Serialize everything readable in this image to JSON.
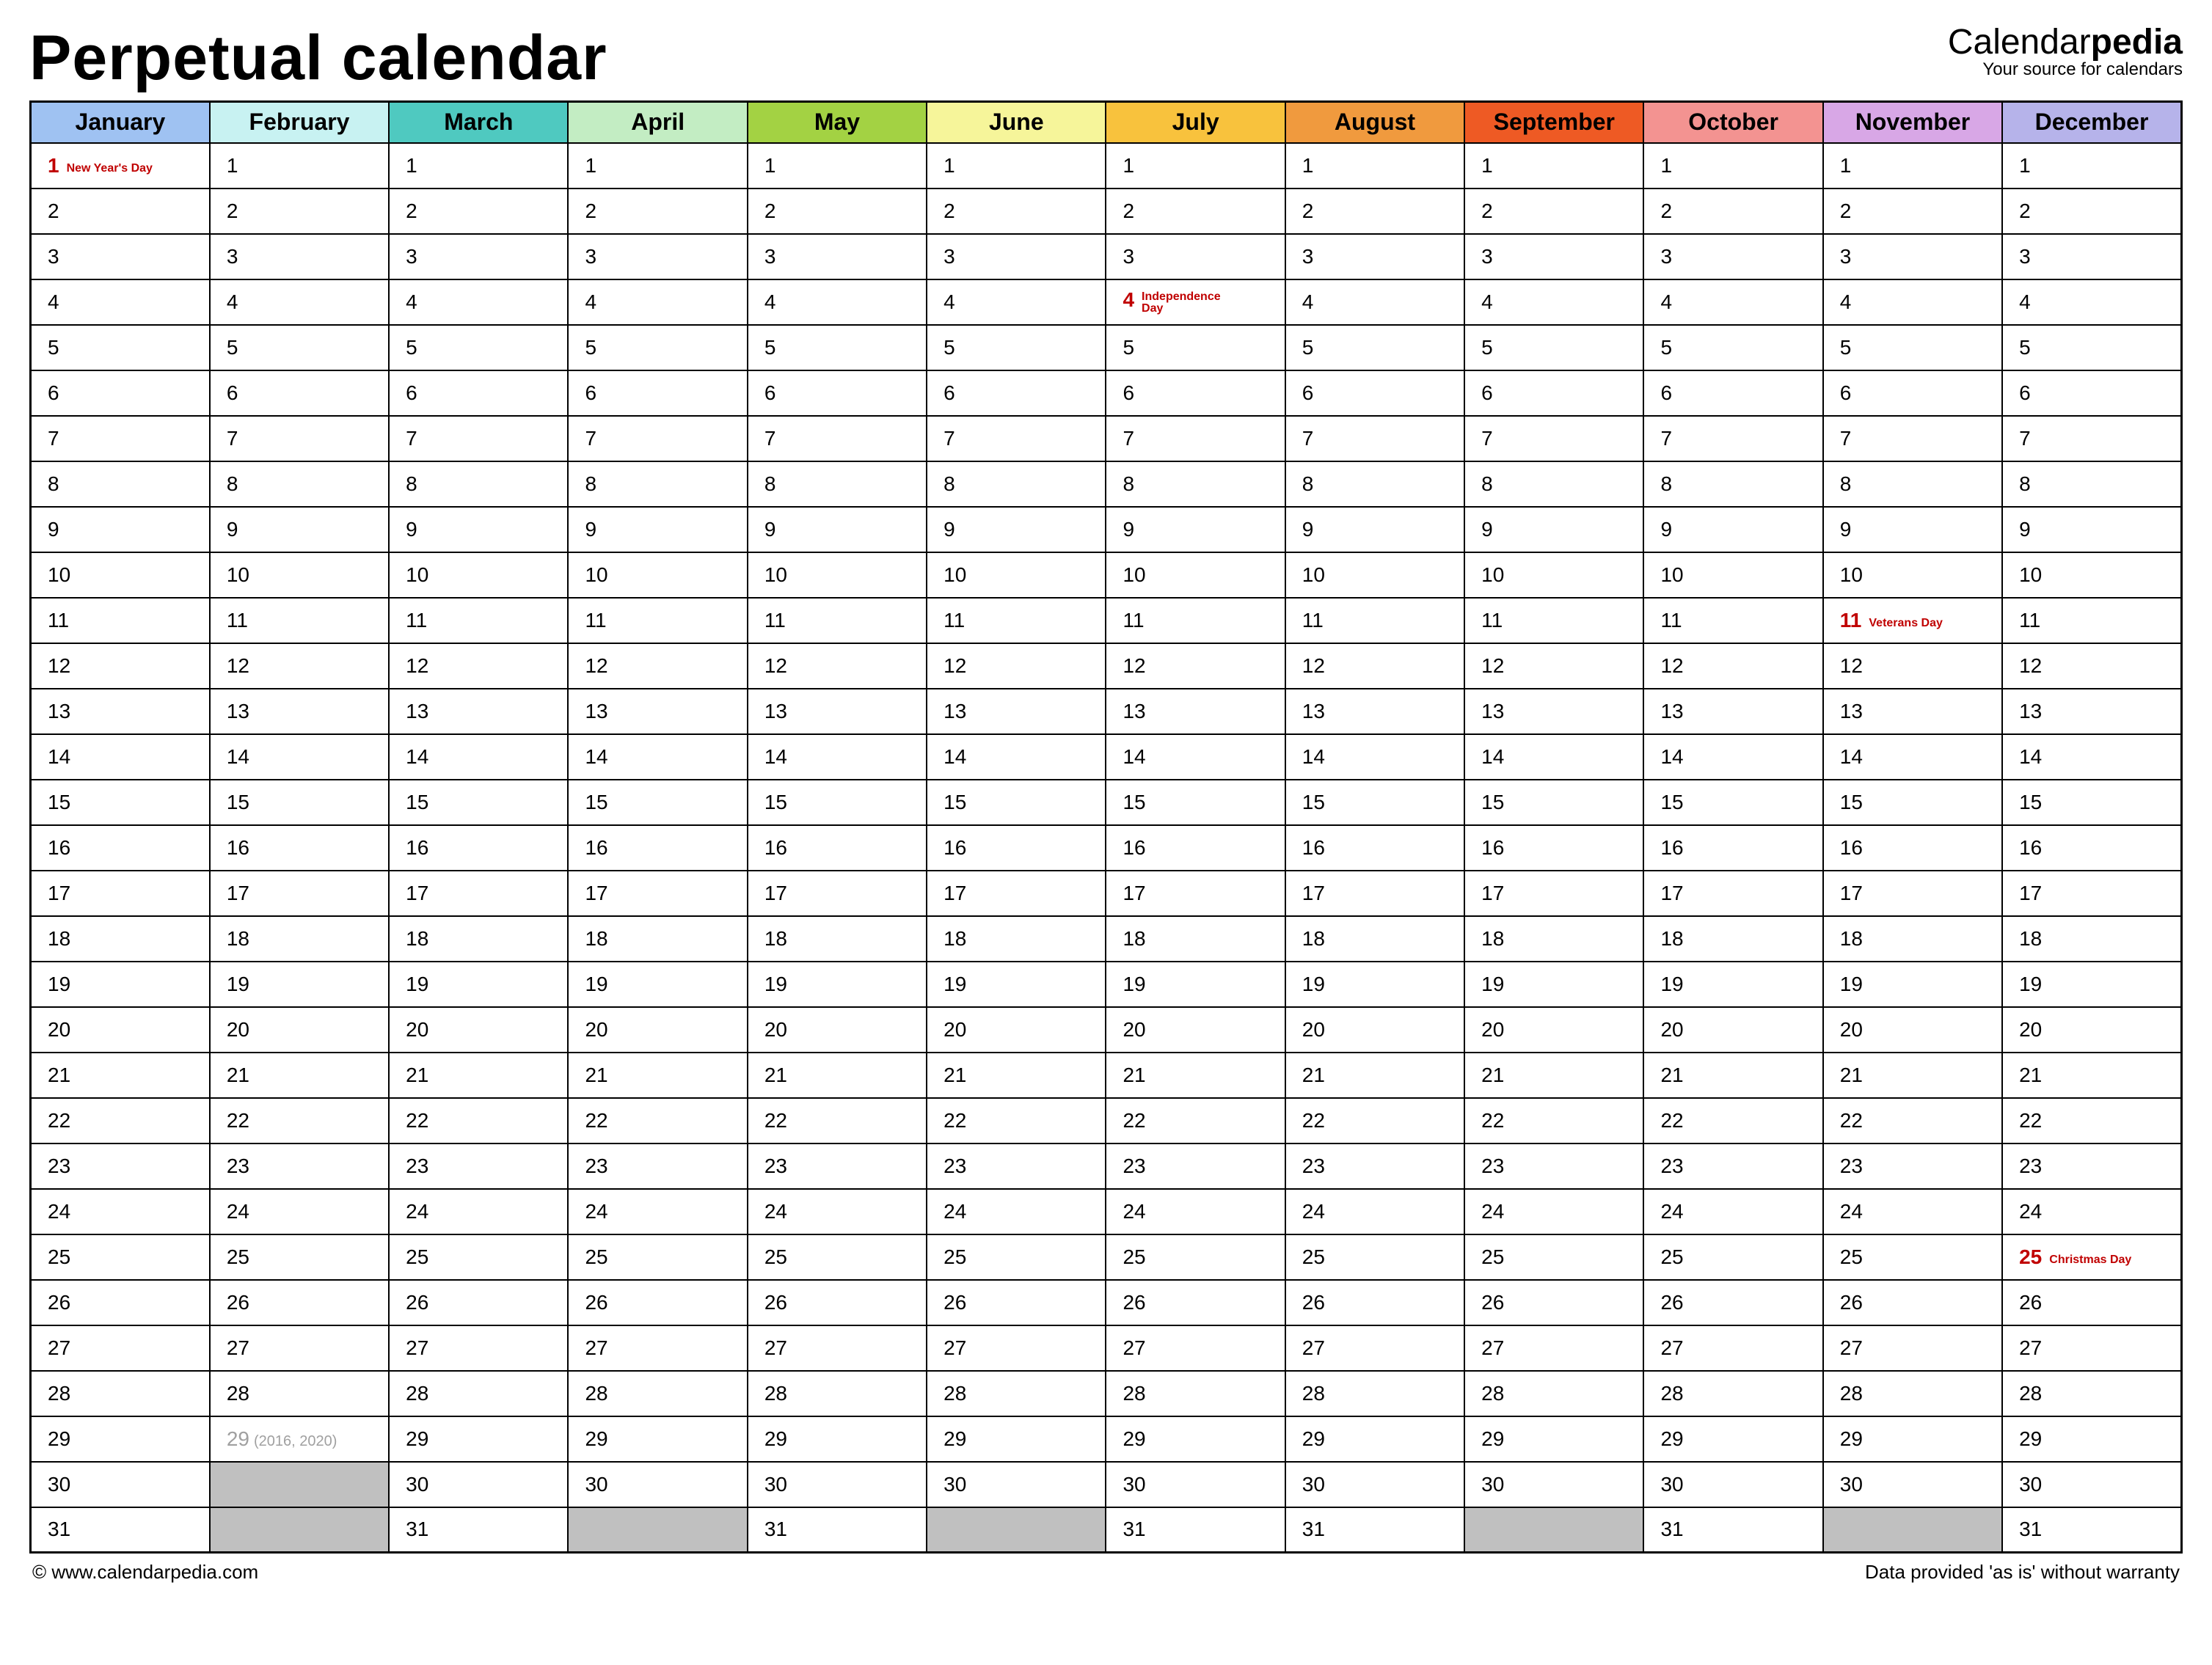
{
  "title": "Perpetual calendar",
  "brand": {
    "plain": "Calendar",
    "bold": "pedia",
    "tagline": "Your source for calendars"
  },
  "footer": {
    "left": "© www.calendarpedia.com",
    "right": "Data provided 'as is' without warranty"
  },
  "months": [
    {
      "name": "January",
      "color": "#9fc2f2",
      "days": 31
    },
    {
      "name": "February",
      "color": "#c8f2f2",
      "days": 29
    },
    {
      "name": "March",
      "color": "#4fc9c0",
      "days": 31
    },
    {
      "name": "April",
      "color": "#c3edc3",
      "days": 30
    },
    {
      "name": "May",
      "color": "#a3d243",
      "days": 31
    },
    {
      "name": "June",
      "color": "#f6f59a",
      "days": 30
    },
    {
      "name": "July",
      "color": "#f8c23d",
      "days": 31
    },
    {
      "name": "August",
      "color": "#f09a3e",
      "days": 31
    },
    {
      "name": "September",
      "color": "#ee5a24",
      "days": 30
    },
    {
      "name": "October",
      "color": "#f39391",
      "days": 31
    },
    {
      "name": "November",
      "color": "#d8a7e6",
      "days": 30
    },
    {
      "name": "December",
      "color": "#b6b3ea",
      "days": 31
    }
  ],
  "max_rows": 31,
  "holidays": {
    "0-1": "New Year's Day",
    "6-4": "Independence Day",
    "10-11": "Veterans Day",
    "11-25": "Christmas Day"
  },
  "leap": {
    "month": 1,
    "day": 29,
    "note": "(2016, 2020)"
  }
}
